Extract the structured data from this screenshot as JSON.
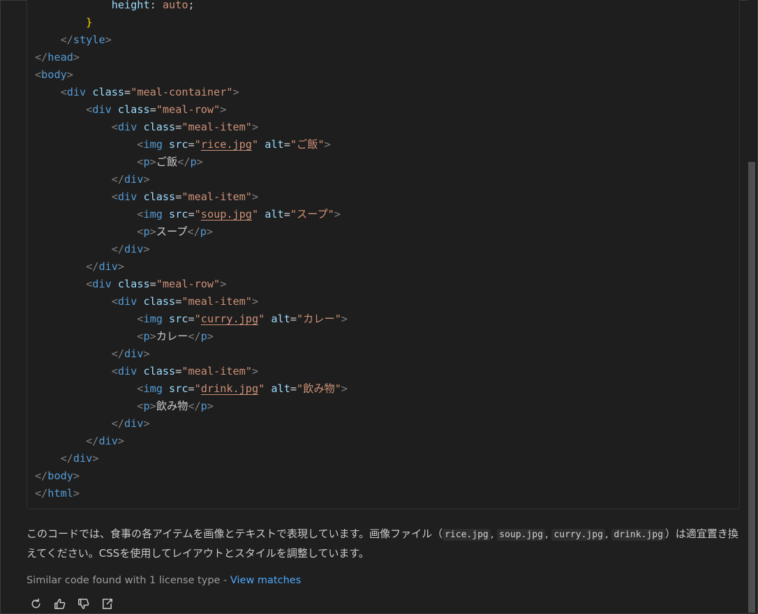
{
  "code": {
    "lines": [
      [
        {
          "c": "prop",
          "t": "            height"
        },
        {
          "c": "plain",
          "t": ": "
        },
        {
          "c": "val",
          "t": "auto"
        },
        {
          "c": "plain",
          "t": ";"
        }
      ],
      [
        {
          "c": "brace",
          "t": "        }"
        }
      ],
      [
        {
          "c": "br",
          "t": "    </"
        },
        {
          "c": "tag",
          "t": "style"
        },
        {
          "c": "br",
          "t": ">"
        }
      ],
      [
        {
          "c": "br",
          "t": "</"
        },
        {
          "c": "tag",
          "t": "head"
        },
        {
          "c": "br",
          "t": ">"
        }
      ],
      [
        {
          "c": "br",
          "t": "<"
        },
        {
          "c": "tag",
          "t": "body"
        },
        {
          "c": "br",
          "t": ">"
        }
      ],
      [
        {
          "c": "br",
          "t": "    <"
        },
        {
          "c": "tag",
          "t": "div"
        },
        {
          "c": "plain",
          "t": " "
        },
        {
          "c": "attr",
          "t": "class"
        },
        {
          "c": "plain",
          "t": "="
        },
        {
          "c": "str",
          "t": "\"meal-container\""
        },
        {
          "c": "br",
          "t": ">"
        }
      ],
      [
        {
          "c": "br",
          "t": "        <"
        },
        {
          "c": "tag",
          "t": "div"
        },
        {
          "c": "plain",
          "t": " "
        },
        {
          "c": "attr",
          "t": "class"
        },
        {
          "c": "plain",
          "t": "="
        },
        {
          "c": "str",
          "t": "\"meal-row\""
        },
        {
          "c": "br",
          "t": ">"
        }
      ],
      [
        {
          "c": "br",
          "t": "            <"
        },
        {
          "c": "tag",
          "t": "div"
        },
        {
          "c": "plain",
          "t": " "
        },
        {
          "c": "attr",
          "t": "class"
        },
        {
          "c": "plain",
          "t": "="
        },
        {
          "c": "str",
          "t": "\"meal-item\""
        },
        {
          "c": "br",
          "t": ">"
        }
      ],
      [
        {
          "c": "br",
          "t": "                <"
        },
        {
          "c": "tag",
          "t": "img"
        },
        {
          "c": "plain",
          "t": " "
        },
        {
          "c": "attr",
          "t": "src"
        },
        {
          "c": "plain",
          "t": "="
        },
        {
          "c": "str",
          "t": "\""
        },
        {
          "c": "link",
          "t": "rice.jpg"
        },
        {
          "c": "str",
          "t": "\""
        },
        {
          "c": "plain",
          "t": " "
        },
        {
          "c": "attr",
          "t": "alt"
        },
        {
          "c": "plain",
          "t": "="
        },
        {
          "c": "str",
          "t": "\"ご飯\""
        },
        {
          "c": "br",
          "t": ">"
        }
      ],
      [
        {
          "c": "br",
          "t": "                <"
        },
        {
          "c": "tag",
          "t": "p"
        },
        {
          "c": "br",
          "t": ">"
        },
        {
          "c": "text",
          "t": "ご飯"
        },
        {
          "c": "br",
          "t": "</"
        },
        {
          "c": "tag",
          "t": "p"
        },
        {
          "c": "br",
          "t": ">"
        }
      ],
      [
        {
          "c": "br",
          "t": "            </"
        },
        {
          "c": "tag",
          "t": "div"
        },
        {
          "c": "br",
          "t": ">"
        }
      ],
      [
        {
          "c": "br",
          "t": "            <"
        },
        {
          "c": "tag",
          "t": "div"
        },
        {
          "c": "plain",
          "t": " "
        },
        {
          "c": "attr",
          "t": "class"
        },
        {
          "c": "plain",
          "t": "="
        },
        {
          "c": "str",
          "t": "\"meal-item\""
        },
        {
          "c": "br",
          "t": ">"
        }
      ],
      [
        {
          "c": "br",
          "t": "                <"
        },
        {
          "c": "tag",
          "t": "img"
        },
        {
          "c": "plain",
          "t": " "
        },
        {
          "c": "attr",
          "t": "src"
        },
        {
          "c": "plain",
          "t": "="
        },
        {
          "c": "str",
          "t": "\""
        },
        {
          "c": "link",
          "t": "soup.jpg"
        },
        {
          "c": "str",
          "t": "\""
        },
        {
          "c": "plain",
          "t": " "
        },
        {
          "c": "attr",
          "t": "alt"
        },
        {
          "c": "plain",
          "t": "="
        },
        {
          "c": "str",
          "t": "\"スープ\""
        },
        {
          "c": "br",
          "t": ">"
        }
      ],
      [
        {
          "c": "br",
          "t": "                <"
        },
        {
          "c": "tag",
          "t": "p"
        },
        {
          "c": "br",
          "t": ">"
        },
        {
          "c": "text",
          "t": "スープ"
        },
        {
          "c": "br",
          "t": "</"
        },
        {
          "c": "tag",
          "t": "p"
        },
        {
          "c": "br",
          "t": ">"
        }
      ],
      [
        {
          "c": "br",
          "t": "            </"
        },
        {
          "c": "tag",
          "t": "div"
        },
        {
          "c": "br",
          "t": ">"
        }
      ],
      [
        {
          "c": "br",
          "t": "        </"
        },
        {
          "c": "tag",
          "t": "div"
        },
        {
          "c": "br",
          "t": ">"
        }
      ],
      [
        {
          "c": "br",
          "t": "        <"
        },
        {
          "c": "tag",
          "t": "div"
        },
        {
          "c": "plain",
          "t": " "
        },
        {
          "c": "attr",
          "t": "class"
        },
        {
          "c": "plain",
          "t": "="
        },
        {
          "c": "str",
          "t": "\"meal-row\""
        },
        {
          "c": "br",
          "t": ">"
        }
      ],
      [
        {
          "c": "br",
          "t": "            <"
        },
        {
          "c": "tag",
          "t": "div"
        },
        {
          "c": "plain",
          "t": " "
        },
        {
          "c": "attr",
          "t": "class"
        },
        {
          "c": "plain",
          "t": "="
        },
        {
          "c": "str",
          "t": "\"meal-item\""
        },
        {
          "c": "br",
          "t": ">"
        }
      ],
      [
        {
          "c": "br",
          "t": "                <"
        },
        {
          "c": "tag",
          "t": "img"
        },
        {
          "c": "plain",
          "t": " "
        },
        {
          "c": "attr",
          "t": "src"
        },
        {
          "c": "plain",
          "t": "="
        },
        {
          "c": "str",
          "t": "\""
        },
        {
          "c": "link",
          "t": "curry.jpg"
        },
        {
          "c": "str",
          "t": "\""
        },
        {
          "c": "plain",
          "t": " "
        },
        {
          "c": "attr",
          "t": "alt"
        },
        {
          "c": "plain",
          "t": "="
        },
        {
          "c": "str",
          "t": "\"カレー\""
        },
        {
          "c": "br",
          "t": ">"
        }
      ],
      [
        {
          "c": "br",
          "t": "                <"
        },
        {
          "c": "tag",
          "t": "p"
        },
        {
          "c": "br",
          "t": ">"
        },
        {
          "c": "text",
          "t": "カレー"
        },
        {
          "c": "br",
          "t": "</"
        },
        {
          "c": "tag",
          "t": "p"
        },
        {
          "c": "br",
          "t": ">"
        }
      ],
      [
        {
          "c": "br",
          "t": "            </"
        },
        {
          "c": "tag",
          "t": "div"
        },
        {
          "c": "br",
          "t": ">"
        }
      ],
      [
        {
          "c": "br",
          "t": "            <"
        },
        {
          "c": "tag",
          "t": "div"
        },
        {
          "c": "plain",
          "t": " "
        },
        {
          "c": "attr",
          "t": "class"
        },
        {
          "c": "plain",
          "t": "="
        },
        {
          "c": "str",
          "t": "\"meal-item\""
        },
        {
          "c": "br",
          "t": ">"
        }
      ],
      [
        {
          "c": "br",
          "t": "                <"
        },
        {
          "c": "tag",
          "t": "img"
        },
        {
          "c": "plain",
          "t": " "
        },
        {
          "c": "attr",
          "t": "src"
        },
        {
          "c": "plain",
          "t": "="
        },
        {
          "c": "str",
          "t": "\""
        },
        {
          "c": "link",
          "t": "drink.jpg"
        },
        {
          "c": "str",
          "t": "\""
        },
        {
          "c": "plain",
          "t": " "
        },
        {
          "c": "attr",
          "t": "alt"
        },
        {
          "c": "plain",
          "t": "="
        },
        {
          "c": "str",
          "t": "\"飲み物\""
        },
        {
          "c": "br",
          "t": ">"
        }
      ],
      [
        {
          "c": "br",
          "t": "                <"
        },
        {
          "c": "tag",
          "t": "p"
        },
        {
          "c": "br",
          "t": ">"
        },
        {
          "c": "text",
          "t": "飲み物"
        },
        {
          "c": "br",
          "t": "</"
        },
        {
          "c": "tag",
          "t": "p"
        },
        {
          "c": "br",
          "t": ">"
        }
      ],
      [
        {
          "c": "br",
          "t": "            </"
        },
        {
          "c": "tag",
          "t": "div"
        },
        {
          "c": "br",
          "t": ">"
        }
      ],
      [
        {
          "c": "br",
          "t": "        </"
        },
        {
          "c": "tag",
          "t": "div"
        },
        {
          "c": "br",
          "t": ">"
        }
      ],
      [
        {
          "c": "br",
          "t": "    </"
        },
        {
          "c": "tag",
          "t": "div"
        },
        {
          "c": "br",
          "t": ">"
        }
      ],
      [
        {
          "c": "br",
          "t": "</"
        },
        {
          "c": "tag",
          "t": "body"
        },
        {
          "c": "br",
          "t": ">"
        }
      ],
      [
        {
          "c": "br",
          "t": "</"
        },
        {
          "c": "tag",
          "t": "html"
        },
        {
          "c": "br",
          "t": ">"
        }
      ]
    ]
  },
  "explanation": {
    "intro": "このコードでは、食事の各アイテムを画像とテキストで表現しています。画像ファイル（",
    "files": [
      "rice.jpg",
      "soup.jpg",
      "curry.jpg",
      "drink.jpg"
    ],
    "sep": ", ",
    "outro": "）は適宜置き換えてください。CSSを使用してレイアウトとスタイルを調整しています。"
  },
  "similar": {
    "text": "Similar code found with 1 license type - ",
    "link": "View matches"
  },
  "actions": [
    {
      "name": "retry-icon",
      "label": "Retry"
    },
    {
      "name": "thumbs-up-icon",
      "label": "Helpful"
    },
    {
      "name": "thumbs-down-icon",
      "label": "Not helpful"
    },
    {
      "name": "insert-icon",
      "label": "Insert"
    }
  ],
  "colors": {
    "background": "#1f1f1f",
    "tag": "#569cd6",
    "attribute": "#9cdcfe",
    "string": "#ce9178",
    "link": "#4daafc"
  }
}
